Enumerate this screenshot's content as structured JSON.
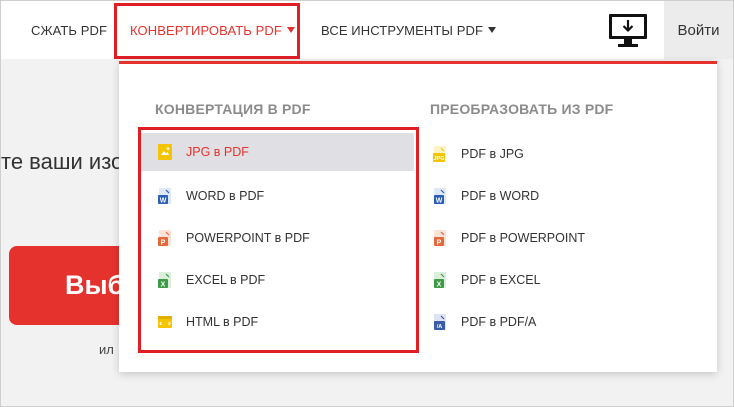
{
  "nav": {
    "compress": "СЖАТЬ PDF",
    "convert": "КОНВЕРТИРОВАТЬ PDF",
    "all_tools": "ВСЕ ИНСТРУМЕНТЫ PDF",
    "desktop_icon": "desktop-download-icon",
    "login": "Войти"
  },
  "background": {
    "headline_fragment": "те ваши изо",
    "select_button_fragment": "Выб",
    "small_fragment": "ил"
  },
  "dropdown": {
    "left_title": "КОНВЕРТАЦИЯ В PDF",
    "right_title": "ПРЕОБРАЗОВАТЬ ИЗ PDF",
    "left_items": [
      {
        "label": "JPG в PDF",
        "icon": "jpg-to-pdf-icon",
        "active": true
      },
      {
        "label": "WORD в PDF",
        "icon": "word-to-pdf-icon"
      },
      {
        "label": "POWERPOINT в PDF",
        "icon": "powerpoint-to-pdf-icon"
      },
      {
        "label": "EXCEL в PDF",
        "icon": "excel-to-pdf-icon"
      },
      {
        "label": "HTML в PDF",
        "icon": "html-to-pdf-icon"
      }
    ],
    "right_items": [
      {
        "label": "PDF в JPG",
        "icon": "pdf-to-jpg-icon"
      },
      {
        "label": "PDF в WORD",
        "icon": "pdf-to-word-icon"
      },
      {
        "label": "PDF в POWERPOINT",
        "icon": "pdf-to-powerpoint-icon"
      },
      {
        "label": "PDF в EXCEL",
        "icon": "pdf-to-excel-icon"
      },
      {
        "label": "PDF в PDF/A",
        "icon": "pdf-to-pdfa-icon"
      }
    ]
  },
  "colors": {
    "accent": "#e5322d",
    "highlight_box": "#e01f25",
    "jpg": "#f5c400",
    "word": "#2b5fb4",
    "powerpoint": "#e26a3c",
    "excel": "#3f9a47",
    "html": "#f5c400",
    "pdfa": "#3a5ba8"
  }
}
